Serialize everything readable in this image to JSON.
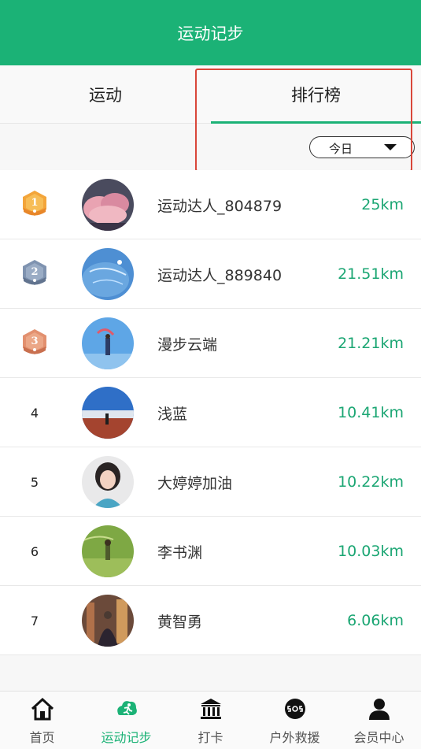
{
  "header": {
    "title": "运动记步"
  },
  "tabs": [
    {
      "label": "运动",
      "active": false
    },
    {
      "label": "排行榜",
      "active": true
    }
  ],
  "filter": {
    "selected": "今日"
  },
  "colors": {
    "brand": "#1bb276",
    "distance": "#1ba673",
    "highlight": "#d9473a"
  },
  "ranking": [
    {
      "rank": "1",
      "medal": "gold",
      "name": "运动达人_804879",
      "distance": "25km"
    },
    {
      "rank": "2",
      "medal": "silver",
      "name": "运动达人_889840",
      "distance": "21.51km"
    },
    {
      "rank": "3",
      "medal": "bronze",
      "name": "漫步云端",
      "distance": "21.21km"
    },
    {
      "rank": "4",
      "medal": "",
      "name": "浅蓝",
      "distance": "10.41km"
    },
    {
      "rank": "5",
      "medal": "",
      "name": "大婷婷加油",
      "distance": "10.22km"
    },
    {
      "rank": "6",
      "medal": "",
      "name": "李书渊",
      "distance": "10.03km"
    },
    {
      "rank": "7",
      "medal": "",
      "name": "黄智勇",
      "distance": "6.06km"
    }
  ],
  "tabbar": [
    {
      "label": "首页",
      "icon": "home-icon",
      "active": false
    },
    {
      "label": "运动记步",
      "icon": "running-icon",
      "active": true
    },
    {
      "label": "打卡",
      "icon": "landmark-icon",
      "active": false
    },
    {
      "label": "户外救援",
      "icon": "sos-icon",
      "active": false
    },
    {
      "label": "会员中心",
      "icon": "user-icon",
      "active": false
    }
  ]
}
